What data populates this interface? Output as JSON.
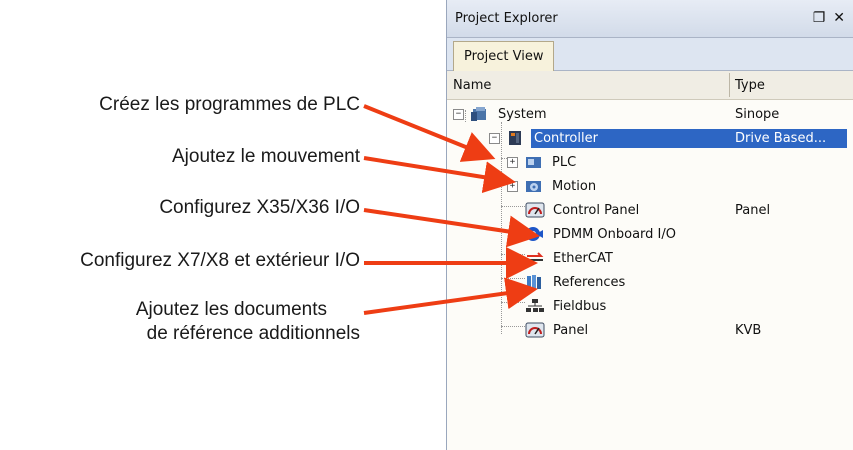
{
  "annotations": [
    "Créez les programmes de PLC",
    "Ajoutez le mouvement",
    "Configurez X35/X36 I/O",
    "Configurez X7/X8 et extérieur I/O",
    "Ajoutez les documents",
    "de référence additionnels"
  ],
  "arrow_color": "#ee3d14",
  "panel": {
    "title": "Project Explorer",
    "tab": "Project View",
    "columns": {
      "name": "Name",
      "type": "Type"
    },
    "tree": [
      {
        "label": "System",
        "type": "Sinope",
        "icon": "system-icon",
        "expand": "-"
      },
      {
        "label": "Controller",
        "type": "Drive Based...",
        "icon": "controller-icon",
        "expand": "-",
        "selected": true
      },
      {
        "label": "PLC",
        "type": "",
        "icon": "plc-icon",
        "expand": "+"
      },
      {
        "label": "Motion",
        "type": "",
        "icon": "motion-icon",
        "expand": "+"
      },
      {
        "label": "Control Panel",
        "type": "Panel",
        "icon": "gauge-icon"
      },
      {
        "label": "PDMM Onboard I/O",
        "type": "",
        "icon": "io-icon"
      },
      {
        "label": "EtherCAT",
        "type": "",
        "icon": "ethercat-icon"
      },
      {
        "label": "References",
        "type": "",
        "icon": "books-icon"
      },
      {
        "label": "Fieldbus",
        "type": "",
        "icon": "fieldbus-icon"
      },
      {
        "label": "Panel",
        "type": "KVB",
        "icon": "gauge-icon"
      }
    ],
    "selected_color": "#2d66c4"
  }
}
